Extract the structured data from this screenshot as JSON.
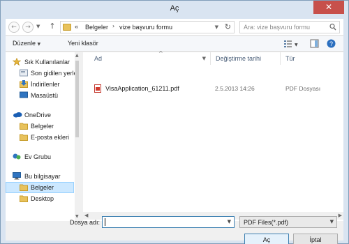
{
  "window": {
    "title": "Aç",
    "close_glyph": "✕"
  },
  "address": {
    "overflow": "«",
    "crumbs": [
      "Belgeler",
      "vize başvuru formu"
    ],
    "search_placeholder": "Ara: vize başvuru formu"
  },
  "toolbar": {
    "organize": "Düzenle",
    "new_folder": "Yeni klasör"
  },
  "nav": {
    "items": [
      {
        "label": "Sık Kullanılanlar",
        "icon": "star-icon"
      },
      {
        "label": "Son gidilen yerle",
        "icon": "recent-places-icon"
      },
      {
        "label": "İndirilenler",
        "icon": "downloads-icon"
      },
      {
        "label": "Masaüstü",
        "icon": "desktop-icon"
      },
      {
        "label": "OneDrive",
        "icon": "cloud-icon"
      },
      {
        "label": "Belgeler",
        "icon": "folder-icon"
      },
      {
        "label": "E-posta ekleri",
        "icon": "folder-icon"
      },
      {
        "label": "Ev Grubu",
        "icon": "homegroup-icon"
      },
      {
        "label": "Bu bilgisayar",
        "icon": "computer-icon"
      },
      {
        "label": "Belgeler",
        "icon": "folder-icon"
      },
      {
        "label": "Desktop",
        "icon": "folder-icon"
      }
    ]
  },
  "columns": {
    "name": "Ad",
    "date": "Değiştirme tarihi",
    "type": "Tür"
  },
  "files": [
    {
      "name": "VisaApplication_61211.pdf",
      "date": "2.5.2013 14:26",
      "type": "PDF Dosyası"
    }
  ],
  "bottom": {
    "filename_label": "Dosya adı:",
    "filename_value": "",
    "filter": "PDF Files(*.pdf)",
    "open": "Aç",
    "cancel": "İptal"
  },
  "colors": {
    "accent": "#3c7fb1",
    "selection": "#cce8ff",
    "close": "#c7504b"
  }
}
